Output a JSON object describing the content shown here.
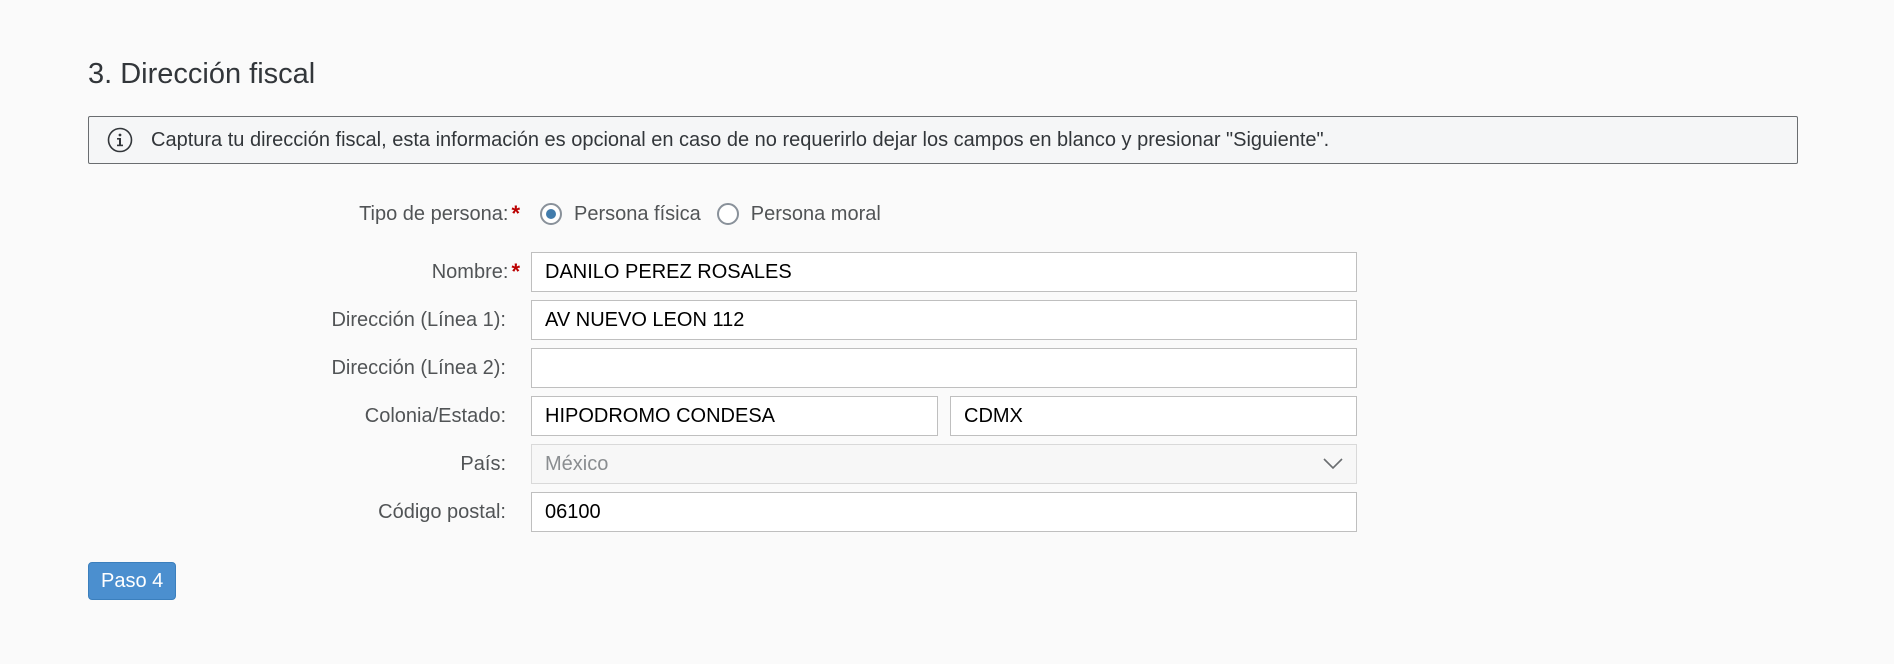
{
  "section": {
    "title": "3. Dirección fiscal"
  },
  "info": {
    "icon": "info-icon",
    "message": "Captura tu dirección fiscal, esta información es opcional en caso de no requerirlo dejar los campos en blanco y presionar \"Siguiente\"."
  },
  "form": {
    "tipo_persona": {
      "label": "Tipo de persona:",
      "required_mark": "*",
      "options": [
        {
          "label": "Persona física",
          "selected": true
        },
        {
          "label": "Persona moral",
          "selected": false
        }
      ]
    },
    "nombre": {
      "label": "Nombre:",
      "required_mark": "*",
      "value": "DANILO PEREZ ROSALES"
    },
    "direccion1": {
      "label": "Dirección (Línea 1):",
      "value": "AV NUEVO LEON 112"
    },
    "direccion2": {
      "label": "Dirección (Línea 2):",
      "value": ""
    },
    "colonia_estado": {
      "label": "Colonia/Estado:",
      "colonia_value": "HIPODROMO CONDESA",
      "estado_value": "CDMX"
    },
    "pais": {
      "label": "País:",
      "selected_value": "México",
      "icon": "chevron-down-icon"
    },
    "codigo_postal": {
      "label": "Código postal:",
      "value": "06100"
    }
  },
  "actions": {
    "step_button_label": "Paso 4"
  },
  "colors": {
    "accent": "#427cac",
    "button": "#4b8fcf",
    "required": "#bb0000",
    "background": "#fafafa"
  }
}
